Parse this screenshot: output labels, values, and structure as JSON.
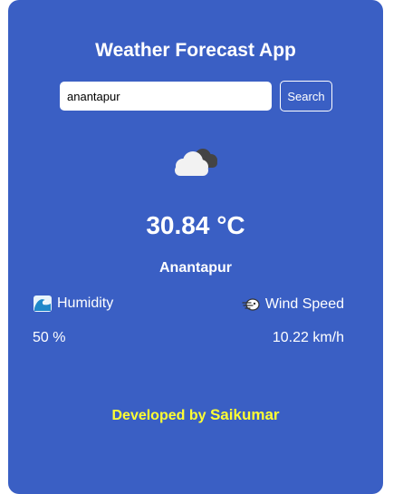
{
  "app": {
    "title": "Weather Forecast App"
  },
  "search": {
    "value": "anantapur",
    "button_label": "Search"
  },
  "weather": {
    "condition_icon": "cloud-icon",
    "temperature": "30.84 °C",
    "city": "Anantapur"
  },
  "details": {
    "humidity_label": "Humidity",
    "humidity_icon": "wave-icon",
    "humidity_value": "50 %",
    "wind_label": "Wind Speed",
    "wind_icon": "wind-icon",
    "wind_value": "10.22 km/h"
  },
  "footer": {
    "prefix": "Developed by",
    "author": "Saikumar"
  },
  "colors": {
    "card_background": "#3a5fc4",
    "text": "#ffffff",
    "footer_text": "#ffff33"
  }
}
